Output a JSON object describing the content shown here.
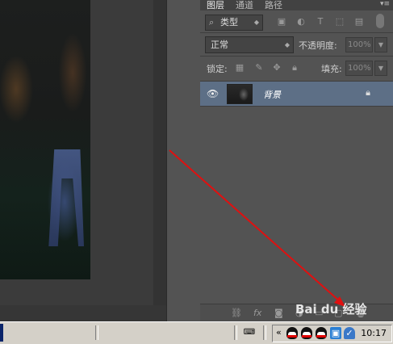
{
  "layers_panel": {
    "tabs": [
      "图层",
      "通道",
      "路径"
    ],
    "menu_glyph": "▾≡",
    "filter_kind": "类型",
    "filter_icons": [
      "image-filter-icon",
      "adjustment-filter-icon",
      "type-filter-icon",
      "shape-filter-icon",
      "smart-object-filter-icon"
    ],
    "blend_mode": "正常",
    "opacity_label": "不透明度:",
    "opacity_value": "100%",
    "lock_label": "锁定:",
    "fill_label": "填充:",
    "fill_value": "100%",
    "layer": {
      "name": "背景",
      "visible": true,
      "locked": true
    },
    "footer_icons": [
      "link-icon",
      "fx-icon",
      "mask-icon",
      "adjustment-icon",
      "group-icon",
      "new-layer-icon",
      "delete-icon"
    ]
  },
  "taskbar": {
    "clock": "10:17",
    "tray_arrow": "«",
    "tray_icons": [
      "qq-icon",
      "qq-icon",
      "qq-icon",
      "network-icon",
      "shield-icon"
    ]
  },
  "watermark": "Bai du 经验",
  "colors": {
    "selected_layer": "#5d6f86",
    "arrow": "#e01010"
  }
}
